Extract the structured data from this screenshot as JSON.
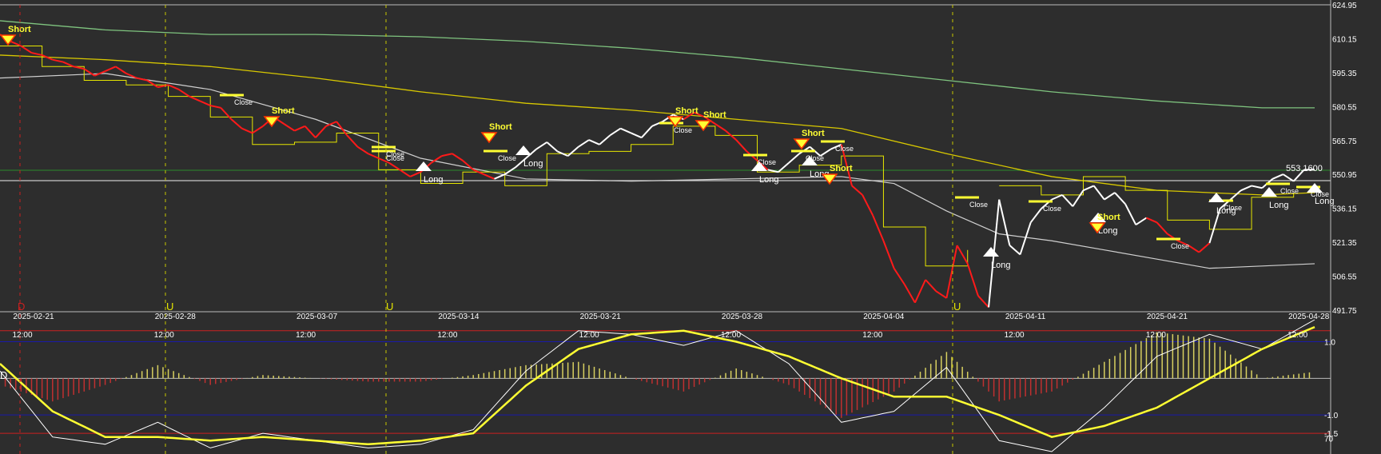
{
  "colors": {
    "background": "#2d2d2d",
    "price_up": "#ffffff",
    "price_down": "#ff1a1a",
    "trail_stop": "#e6e600",
    "ma_fast": "#d0d0d0",
    "ma_mid": "#d8c800",
    "ma_slow": "#7fc47f",
    "hist_pos": "#d8d060",
    "hist_neg": "#c03030",
    "osc_fast": "#ffffff",
    "osc_slow": "#ffff33",
    "level_line": "#1a1aaa",
    "level_red": "#cc2020",
    "horizontal_green": "#2a8a2a"
  },
  "chart_data": [
    {
      "type": "line",
      "panel": "price",
      "ylim": [
        491.75,
        624.95
      ],
      "y_ticks": [
        "624.95",
        "610.15",
        "595.35",
        "580.55",
        "565.75",
        "550.95",
        "536.15",
        "521.35",
        "506.55",
        "491.75"
      ],
      "last_price_label": "553.1600",
      "x_tick_dates": [
        "2025-02-21",
        "2025-02-28",
        "2025-03-07",
        "2025-03-14",
        "2025-03-21",
        "2025-03-28",
        "2025-04-04",
        "2025-04-11",
        "2025-04-21",
        "2025-04-28"
      ],
      "x_tick_times": [
        "12:00",
        "12:00",
        "12:00",
        "12:00",
        "12:00",
        "12:00",
        "12:00",
        "12:00",
        "12:00",
        "12:00"
      ],
      "series": [
        {
          "role": "price",
          "x": [
            0,
            2,
            4,
            6,
            8,
            10,
            12,
            14,
            16,
            18,
            20,
            22,
            24,
            26,
            28,
            30,
            32,
            34,
            36,
            38,
            40,
            42,
            44,
            46,
            48,
            50,
            52,
            54,
            56,
            58,
            60,
            62,
            64,
            66,
            68,
            70,
            72,
            74,
            76,
            78,
            80,
            82,
            84,
            86,
            88,
            90,
            92,
            94,
            96,
            98,
            100,
            102,
            104,
            106,
            108,
            110,
            112,
            114,
            116,
            118,
            120,
            122,
            124,
            126,
            128,
            130,
            132,
            134,
            136,
            138,
            140,
            142,
            144,
            146,
            148,
            150,
            152,
            154,
            156,
            158,
            160,
            162,
            164,
            166,
            168,
            170,
            172,
            174,
            176,
            178,
            180,
            182,
            184,
            186,
            188,
            190
          ],
          "values": [
            612,
            609,
            607,
            604,
            603,
            601,
            600,
            598,
            597,
            594,
            596,
            598,
            595,
            593,
            592,
            589,
            590,
            588,
            585,
            583,
            581,
            580,
            575,
            571,
            569,
            572,
            576,
            573,
            570,
            572,
            567,
            572,
            574,
            568,
            563,
            560,
            558,
            556,
            553,
            550,
            552,
            556,
            559,
            560,
            557,
            553,
            551,
            549,
            551,
            554,
            558,
            562,
            565,
            561,
            559,
            563,
            566,
            564,
            568,
            571,
            569,
            567,
            572,
            574,
            577,
            575,
            578,
            576,
            573,
            570,
            566,
            561,
            557,
            553,
            552,
            556,
            560,
            563,
            559,
            562,
            564,
            546,
            542,
            533,
            522,
            510,
            503,
            495,
            505,
            500,
            497,
            520,
            512,
            498,
            493,
            540
          ]
        },
        {
          "role": "price_second_half",
          "x": [
            190,
            192,
            194,
            196,
            198,
            200,
            202,
            204,
            206,
            208,
            210,
            212,
            214,
            216,
            218,
            220,
            222,
            224,
            226,
            228,
            230,
            232,
            234,
            236,
            238,
            240,
            242,
            244,
            246,
            248,
            250
          ],
          "values": [
            540,
            520,
            516,
            530,
            536,
            540,
            542,
            537,
            544,
            546,
            540,
            543,
            538,
            529,
            532,
            530,
            525,
            522,
            520,
            517,
            521,
            536,
            540,
            544,
            546,
            545,
            549,
            551,
            548,
            553,
            553
          ]
        },
        {
          "role": "ma_fast",
          "x": [
            0,
            20,
            40,
            60,
            80,
            100,
            120,
            140,
            160,
            170,
            180,
            190,
            200,
            210,
            220,
            230,
            240,
            250
          ],
          "values": [
            593,
            595,
            588,
            575,
            558,
            549,
            548,
            549,
            550,
            547,
            535,
            525,
            522,
            518,
            514,
            510,
            511,
            512
          ]
        },
        {
          "role": "ma_mid",
          "x": [
            0,
            20,
            40,
            60,
            80,
            100,
            120,
            140,
            160,
            180,
            200,
            220,
            240,
            250
          ],
          "values": [
            603,
            601,
            598,
            593,
            587,
            582,
            579,
            575,
            571,
            560,
            550,
            544,
            542,
            543
          ]
        },
        {
          "role": "ma_slow",
          "x": [
            0,
            20,
            40,
            60,
            80,
            100,
            120,
            140,
            160,
            180,
            200,
            220,
            240,
            250
          ],
          "values": [
            618,
            614,
            612,
            612,
            611,
            609,
            606,
            602,
            597,
            592,
            587,
            583,
            580,
            580
          ]
        }
      ],
      "signals": [
        {
          "kind": "short",
          "text": "Short"
        },
        {
          "kind": "close",
          "text": "Close"
        },
        {
          "kind": "short",
          "text": "Short"
        },
        {
          "kind": "close",
          "text": "Close"
        },
        {
          "kind": "long",
          "text": "Long"
        },
        {
          "kind": "close",
          "text": "Close"
        },
        {
          "kind": "short",
          "text": "Short"
        },
        {
          "kind": "close",
          "text": "Close"
        },
        {
          "kind": "long",
          "text": "Long"
        },
        {
          "kind": "close",
          "text": "Close"
        },
        {
          "kind": "short",
          "text": "Short"
        },
        {
          "kind": "short",
          "text": "Short"
        },
        {
          "kind": "close",
          "text": "Close"
        },
        {
          "kind": "long",
          "text": "Long"
        },
        {
          "kind": "short",
          "text": "Short"
        },
        {
          "kind": "close",
          "text": "Close"
        },
        {
          "kind": "long",
          "text": "Long"
        },
        {
          "kind": "close",
          "text": "Close"
        },
        {
          "kind": "short",
          "text": "Short"
        },
        {
          "kind": "close",
          "text": "Close"
        },
        {
          "kind": "long",
          "text": "Long"
        },
        {
          "kind": "close",
          "text": "Close"
        },
        {
          "kind": "long",
          "text": "Long"
        },
        {
          "kind": "close",
          "text": "Close"
        },
        {
          "kind": "short",
          "text": "Short"
        },
        {
          "kind": "close",
          "text": "Close"
        },
        {
          "kind": "long",
          "text": "Long"
        },
        {
          "kind": "close",
          "text": "Close"
        },
        {
          "kind": "long",
          "text": "Long"
        },
        {
          "kind": "close",
          "text": "Close"
        },
        {
          "kind": "long",
          "text": "Long"
        }
      ],
      "markers": [
        "D",
        "U",
        "U",
        "U"
      ]
    },
    {
      "type": "line",
      "panel": "oscillator",
      "ylim": [
        -2.0,
        1.6
      ],
      "y_ticks": [
        "1.0",
        "-1.0",
        "-1.5"
      ],
      "y_tick_overlap": "70",
      "marker": "D",
      "series": [
        {
          "role": "osc_fast",
          "x": [
            0,
            10,
            20,
            30,
            40,
            50,
            60,
            70,
            80,
            90,
            100,
            110,
            120,
            130,
            140,
            150,
            160,
            170,
            180,
            190,
            200,
            210,
            220,
            230,
            240,
            250
          ],
          "values": [
            0.2,
            -1.6,
            -1.8,
            -1.2,
            -1.9,
            -1.5,
            -1.7,
            -1.9,
            -1.8,
            -1.4,
            0.2,
            1.3,
            1.2,
            0.9,
            1.3,
            0.4,
            -1.2,
            -0.9,
            0.3,
            -1.7,
            -2.0,
            -0.8,
            0.6,
            1.2,
            0.8,
            1.6
          ]
        },
        {
          "role": "osc_slow",
          "x": [
            0,
            10,
            20,
            30,
            40,
            50,
            60,
            70,
            80,
            90,
            100,
            110,
            120,
            130,
            140,
            150,
            160,
            170,
            180,
            190,
            200,
            210,
            220,
            230,
            240,
            250
          ],
          "values": [
            0.4,
            -0.9,
            -1.6,
            -1.6,
            -1.7,
            -1.6,
            -1.7,
            -1.8,
            -1.7,
            -1.5,
            -0.2,
            0.8,
            1.2,
            1.3,
            1.0,
            0.6,
            0.0,
            -0.5,
            -0.5,
            -1.0,
            -1.6,
            -1.3,
            -0.8,
            0.0,
            0.8,
            1.4
          ]
        }
      ]
    }
  ]
}
